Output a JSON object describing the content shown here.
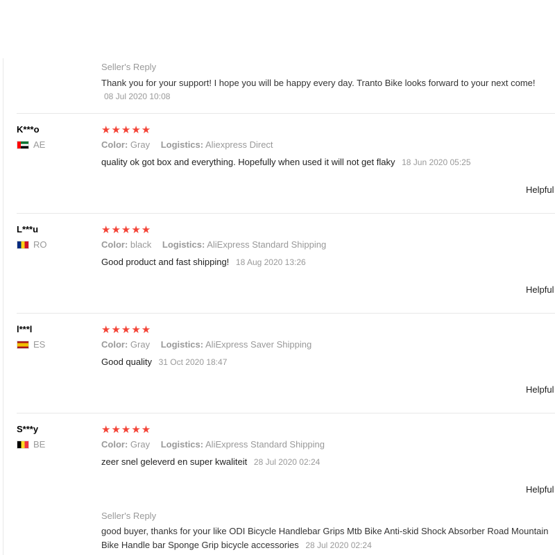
{
  "top_reply": {
    "title": "Seller's Reply",
    "text": "Thank you for your support! I hope you will be happy every day. Tranto Bike looks forward to your next come!",
    "date": "08 Jul 2020 10:08"
  },
  "labels": {
    "color": "Color:",
    "logistics": "Logistics:",
    "helpful": "Helpful"
  },
  "reviews": [
    {
      "user": "K***o",
      "country": "AE",
      "flag": "flag-ae-icon",
      "stars": "★★★★★",
      "rating": 5,
      "color": "Gray",
      "logistics": "Aliexpress Direct",
      "comment": "quality ok got box and everything. Hopefully when used it will not get flaky",
      "date": "18 Jun 2020 05:25"
    },
    {
      "user": "L***u",
      "country": "RO",
      "flag": "flag-ro-icon",
      "stars": "★★★★★",
      "rating": 5,
      "color": "black",
      "logistics": "AliExpress Standard Shipping",
      "comment": "Good product and fast shipping!",
      "date": "18 Aug 2020 13:26"
    },
    {
      "user": "l***l",
      "country": "ES",
      "flag": "flag-es-icon",
      "stars": "★★★★★",
      "rating": 5,
      "color": "Gray",
      "logistics": "AliExpress Saver Shipping",
      "comment": "Good quality",
      "date": "31 Oct 2020 18:47"
    },
    {
      "user": "S***y",
      "country": "BE",
      "flag": "flag-be-icon",
      "stars": "★★★★★",
      "rating": 5,
      "color": "Gray",
      "logistics": "AliExpress Standard Shipping",
      "comment": "zeer snel geleverd en super kwaliteit",
      "date": "28 Jul 2020 02:24"
    }
  ],
  "bottom_reply": {
    "title": "Seller's Reply",
    "text_line1": "good buyer, thanks for your like ODI Bicycle Handlebar Grips Mtb Bike Anti-skid Shock Absorber Road Mountain",
    "text_line2": "Bike Handle bar Sponge Grip bicycle accessories",
    "date": "28 Jul 2020 02:24"
  }
}
